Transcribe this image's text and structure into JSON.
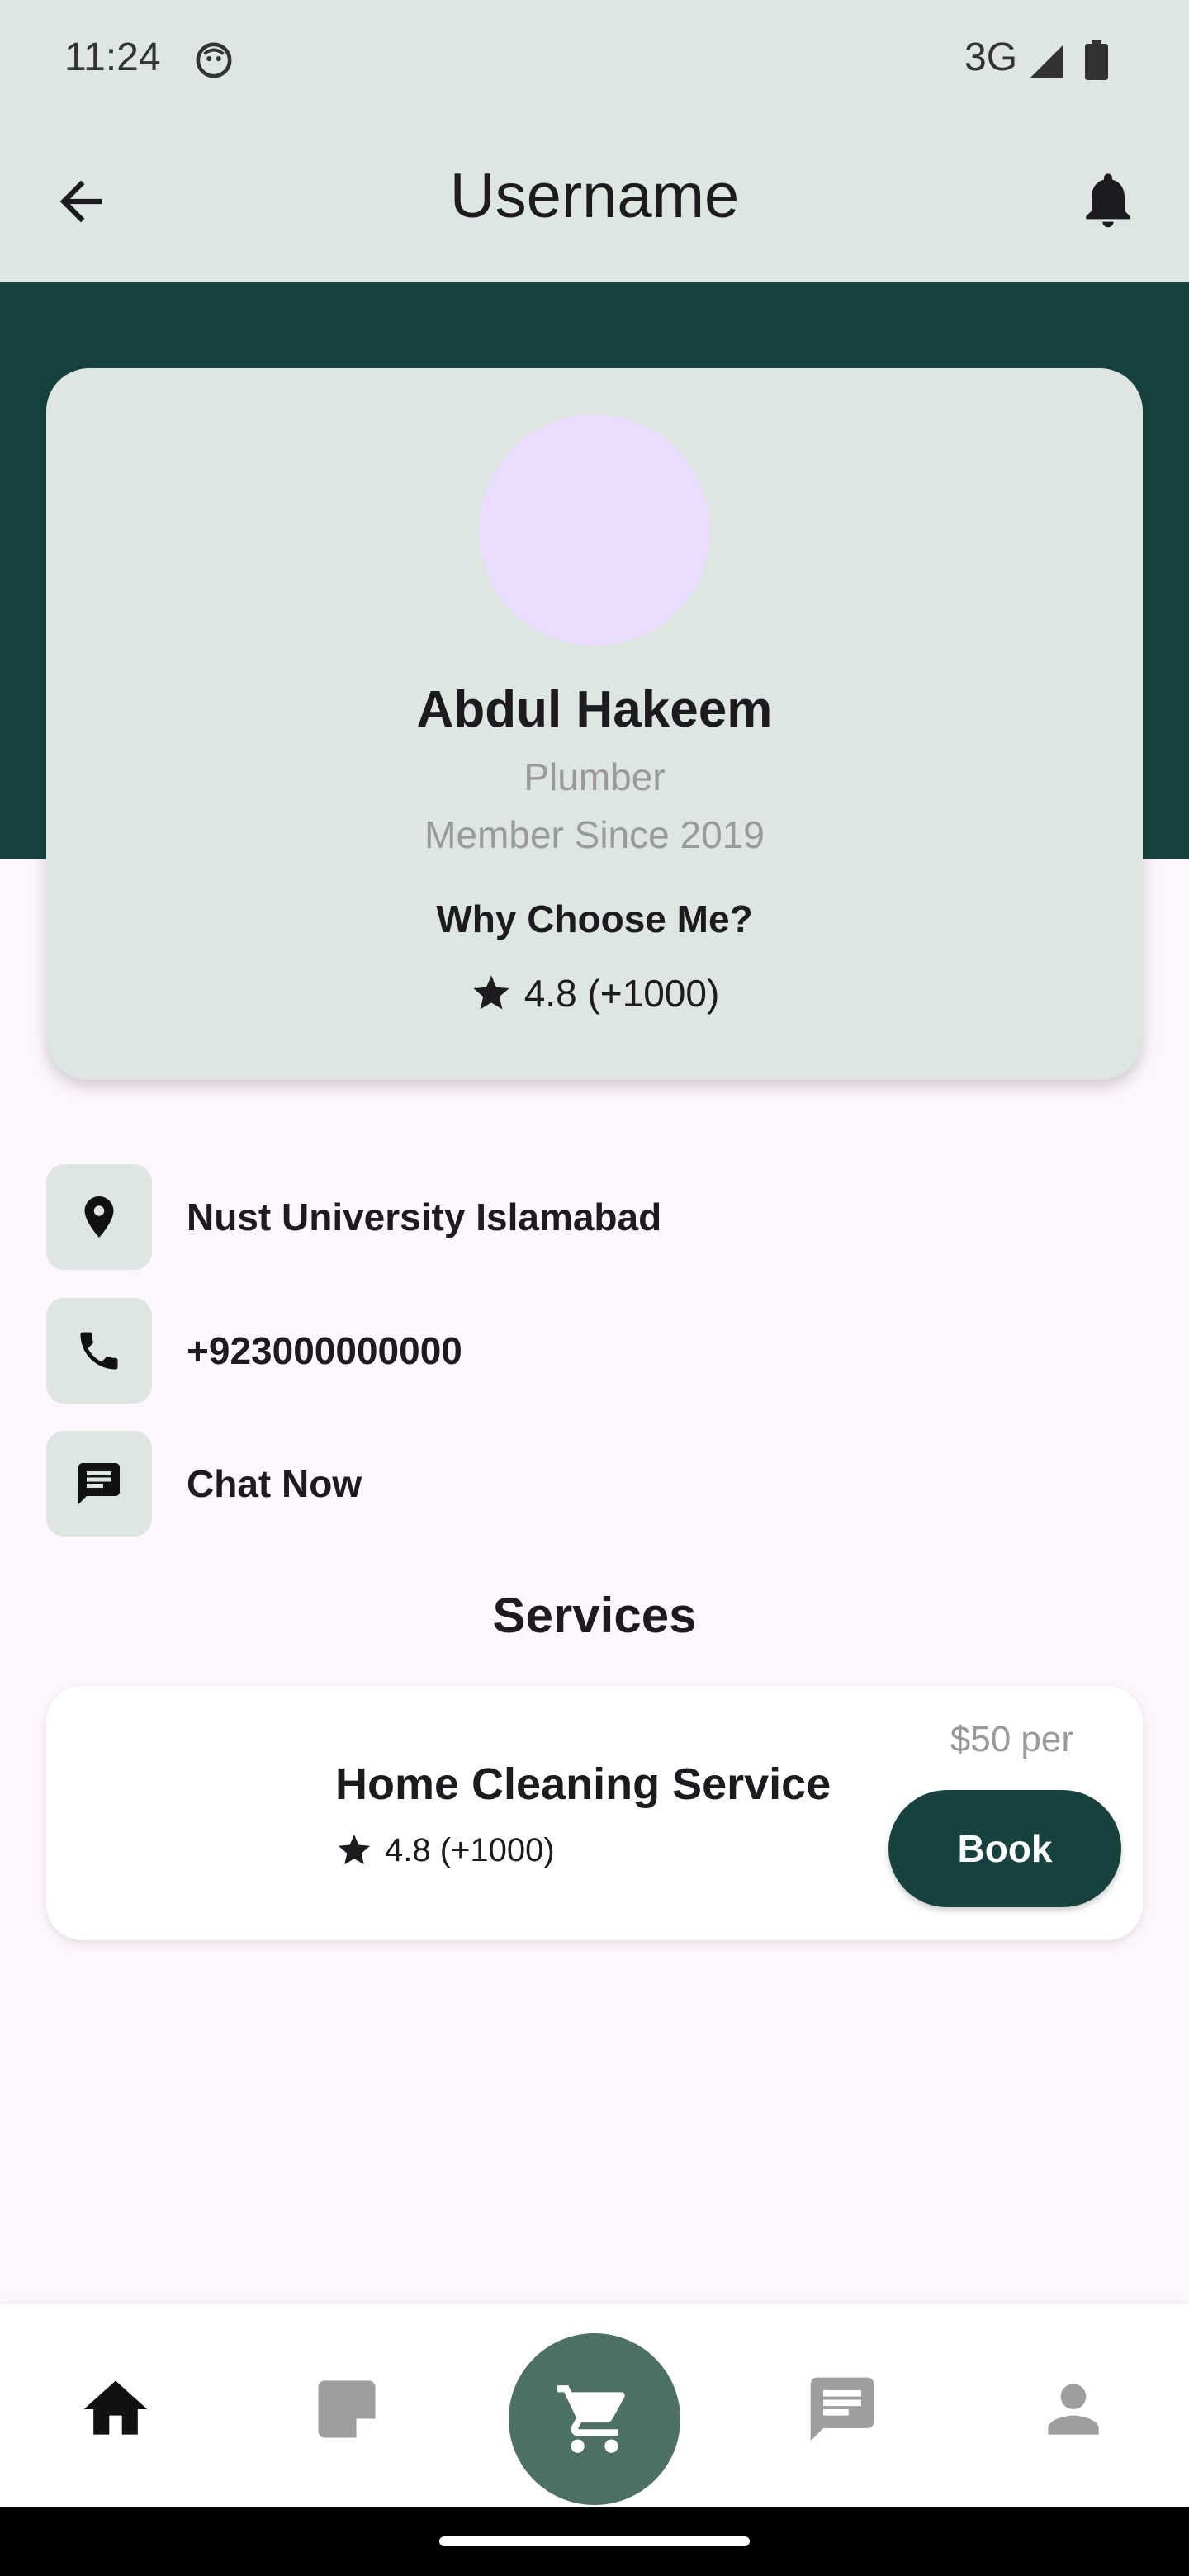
{
  "status_bar": {
    "time": "11:24",
    "network": "3G"
  },
  "app_bar": {
    "title": "Username"
  },
  "profile": {
    "name": "Abdul Hakeem",
    "profession": "Plumber",
    "member_since": "Member Since 2019",
    "why_choose": "Why Choose Me?",
    "rating": "4.8 (+1000)",
    "avatar_color": "#EADDFF"
  },
  "contact": {
    "location": "Nust University Islamabad",
    "phone": "+923000000000",
    "chat": "Chat Now"
  },
  "services": {
    "title": "Services",
    "items": [
      {
        "name": "Home Cleaning Service",
        "rating": "4.8 (+1000)",
        "price": "$50 per",
        "book_label": "Book"
      }
    ]
  },
  "bottom_nav": {
    "items": [
      "home-icon",
      "orders-icon",
      "cart-icon",
      "messages-icon",
      "profile-icon"
    ],
    "active": "home-icon"
  },
  "colors": {
    "accent_dark": "#174240",
    "surface": "#DDE6E0",
    "background": "#FDF6FC",
    "cart_fab": "#4D7163"
  }
}
